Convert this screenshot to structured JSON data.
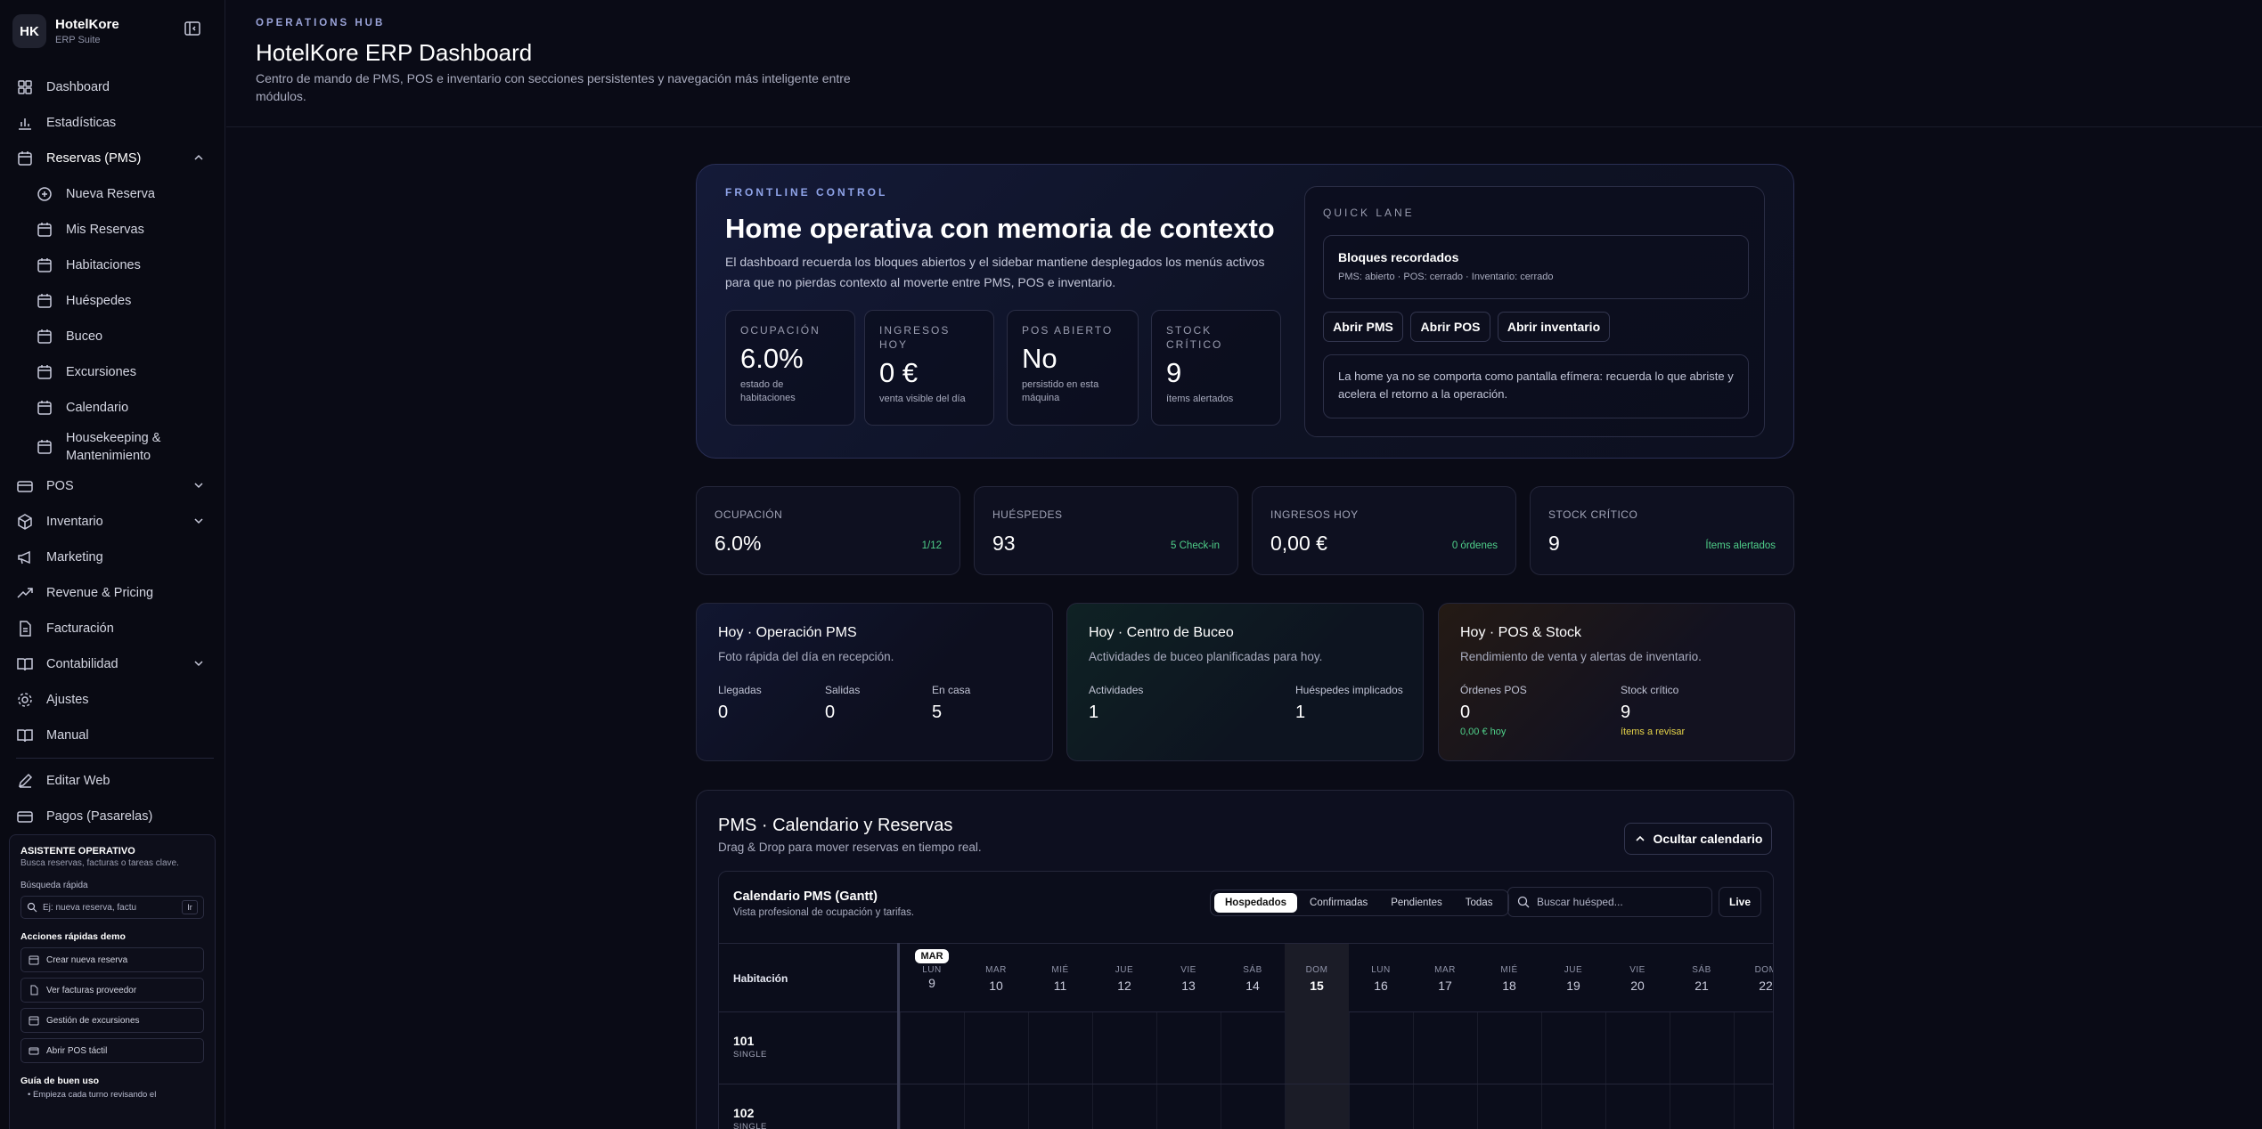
{
  "brand": {
    "logo": "HK",
    "name": "HotelKore",
    "sub": "ERP Suite"
  },
  "nav": {
    "dashboard": "Dashboard",
    "estadisticas": "Estadísticas",
    "reservas": "Reservas (PMS)",
    "nueva_reserva": "Nueva Reserva",
    "mis_reservas": "Mis Reservas",
    "habitaciones": "Habitaciones",
    "huespedes": "Huéspedes",
    "buceo": "Buceo",
    "excursiones": "Excursiones",
    "calendario": "Calendario",
    "housekeeping": "Housekeeping & Mantenimiento",
    "pos": "POS",
    "inventario": "Inventario",
    "marketing": "Marketing",
    "revenue": "Revenue & Pricing",
    "facturacion": "Facturación",
    "contabilidad": "Contabilidad",
    "ajustes": "Ajustes",
    "manual": "Manual",
    "editar_web": "Editar Web",
    "pagos": "Pagos (Pasarelas)"
  },
  "assistant": {
    "title": "ASISTENTE OPERATIVO",
    "sub": "Busca reservas, facturas o tareas clave.",
    "search_label": "Búsqueda rápida",
    "search_placeholder": "Ej: nueva reserva, factu",
    "search_go": "Ir",
    "actions_title": "Acciones rápidas demo",
    "actions": [
      "Crear nueva reserva",
      "Ver facturas proveedor",
      "Gestión de excursiones",
      "Abrir POS táctil"
    ],
    "guide_title": "Guía de buen uso",
    "guide_bullet": "• Empieza cada turno revisando el"
  },
  "header": {
    "eyebrow": "OPERATIONS HUB",
    "title": "HotelKore ERP Dashboard",
    "desc": "Centro de mando de PMS, POS e inventario con secciones persistentes y navegación más inteligente entre módulos."
  },
  "hero": {
    "eyebrow": "FRONTLINE CONTROL",
    "title": "Home operativa con memoria de contexto",
    "desc": "El dashboard recuerda los bloques abiertos y el sidebar mantiene desplegados los menús activos para que no pierdas contexto al moverte entre PMS, POS e inventario.",
    "kpis": [
      {
        "label": "OCUPACIÓN",
        "value": "6.0%",
        "note": "estado de habitaciones"
      },
      {
        "label": "INGRESOS HOY",
        "value": "0 €",
        "note": "venta visible del día"
      },
      {
        "label": "POS ABIERTO",
        "value": "No",
        "note": "persistido en esta máquina"
      },
      {
        "label": "STOCK CRÍTICO",
        "value": "9",
        "note": "ítems alertados"
      }
    ],
    "quick": {
      "eyebrow": "QUICK LANE",
      "box_title": "Bloques recordados",
      "box_sub": "PMS: abierto · POS: cerrado · Inventario: cerrado",
      "btn_pms": "Abrir PMS",
      "btn_pos": "Abrir POS",
      "btn_inv": "Abrir inventario",
      "note": "La home ya no se comporta como pantalla efímera: recuerda lo que abriste y acelera el retorno a la operación."
    }
  },
  "stats": [
    {
      "label": "OCUPACIÓN",
      "value": "6.0%",
      "note": "1/12"
    },
    {
      "label": "HUÉSPEDES",
      "value": "93",
      "note": "5 Check-in"
    },
    {
      "label": "INGRESOS HOY",
      "value": "0,00 €",
      "note": "0 órdenes"
    },
    {
      "label": "STOCK CRÍTICO",
      "value": "9",
      "note": "Ítems alertados"
    }
  ],
  "ops": {
    "pms": {
      "title": "Hoy · Operación PMS",
      "sub": "Foto rápida del día en recepción.",
      "llegadas_k": "Llegadas",
      "llegadas_v": "0",
      "salidas_k": "Salidas",
      "salidas_v": "0",
      "encasa_k": "En casa",
      "encasa_v": "5"
    },
    "buceo": {
      "title": "Hoy · Centro de Buceo",
      "sub": "Actividades de buceo planificadas para hoy.",
      "act_k": "Actividades",
      "act_v": "1",
      "hue_k": "Huéspedes implicados",
      "hue_v": "1"
    },
    "pos": {
      "title": "Hoy · POS & Stock",
      "sub": "Rendimiento de venta y alertas de inventario.",
      "ord_k": "Órdenes POS",
      "ord_v": "0",
      "ord_note": "0,00 € hoy",
      "stock_k": "Stock crítico",
      "stock_v": "9",
      "stock_note": "ítems a revisar"
    }
  },
  "calendar": {
    "title": "PMS · Calendario y Reservas",
    "sub": "Drag & Drop para mover reservas en tiempo real.",
    "hide_btn": "Ocultar calendario",
    "gantt_title": "Calendario PMS (Gantt)",
    "gantt_sub": "Vista profesional de ocupación y tarifas.",
    "filters": [
      "Hospedados",
      "Confirmadas",
      "Pendientes",
      "Todas"
    ],
    "search_placeholder": "Buscar huésped...",
    "live": "Live",
    "room_header": "Habitación",
    "month": "MAR",
    "days": [
      {
        "dn": "LUN",
        "dd": "9"
      },
      {
        "dn": "MAR",
        "dd": "10"
      },
      {
        "dn": "MIÉ",
        "dd": "11"
      },
      {
        "dn": "JUE",
        "dd": "12"
      },
      {
        "dn": "VIE",
        "dd": "13"
      },
      {
        "dn": "SÁB",
        "dd": "14"
      },
      {
        "dn": "DOM",
        "dd": "15"
      },
      {
        "dn": "LUN",
        "dd": "16"
      },
      {
        "dn": "MAR",
        "dd": "17"
      },
      {
        "dn": "MIÉ",
        "dd": "18"
      },
      {
        "dn": "JUE",
        "dd": "19"
      },
      {
        "dn": "VIE",
        "dd": "20"
      },
      {
        "dn": "SÁB",
        "dd": "21"
      },
      {
        "dn": "DOM",
        "dd": "22"
      }
    ],
    "rooms": [
      {
        "num": "101",
        "type": "SINGLE"
      },
      {
        "num": "102",
        "type": "SINGLE"
      }
    ]
  },
  "colors": {
    "accent_green": "#4fd08a",
    "accent_yellow": "#e5d34a",
    "background": "#0a0b16"
  }
}
